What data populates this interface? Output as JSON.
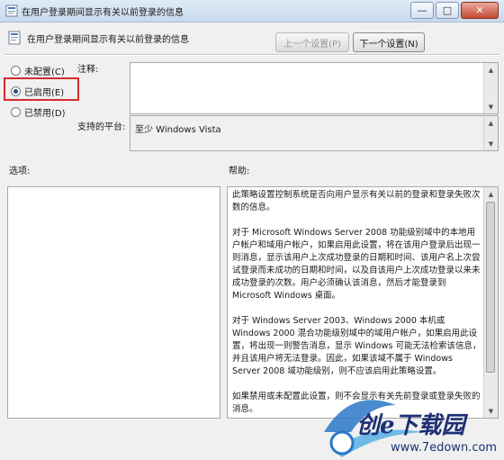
{
  "window": {
    "title": "在用户登录期间显示有关以前登录的信息"
  },
  "header": {
    "setting_name": "在用户登录期间显示有关以前登录的信息",
    "prev_button": "上一个设置(P)",
    "next_button": "下一个设置(N)"
  },
  "options": {
    "not_configured": "未配置(C)",
    "enabled": "已启用(E)",
    "disabled": "已禁用(D)",
    "selected": "enabled"
  },
  "comment": {
    "label": "注释:",
    "value": ""
  },
  "supported": {
    "label": "支持的平台:",
    "value": "至少 Windows Vista"
  },
  "sections": {
    "options_label": "选项:",
    "help_label": "帮助:"
  },
  "help": {
    "paragraphs": [
      "此策略设置控制系统是否向用户显示有关以前的登录和登录失败次数的信息。",
      "对于 Microsoft Windows Server 2008 功能级别域中的本地用户帐户和域用户帐户，如果启用此设置，将在该用户登录后出现一则消息，显示该用户上次成功登录的日期和时间、该用户名上次尝试登录而未成功的日期和时间，以及自该用户上次成功登录以来未成功登录的次数。用户必须确认该消息，然后才能登录到 Microsoft Windows 桌面。",
      "对于 Windows Server 2003、Windows 2000 本机或 Windows 2000 混合功能级别域中的域用户帐户，如果启用此设置，将出现一则警告消息，显示 Windows 可能无法检索该信息，并且该用户将无法登录。因此，如果该域不属于 Windows Server 2008 域功能级别，则不应该启用此策略设置。",
      "如果禁用或未配置此设置，则不会显示有关先前登录或登录失败的消息。"
    ]
  },
  "watermark": {
    "brand": "创e下载园",
    "url": "www.7edown.com"
  },
  "colors": {
    "highlight": "#d42c2c",
    "title_gradient_top": "#dfeaf6",
    "watermark": "#1d2f73"
  }
}
